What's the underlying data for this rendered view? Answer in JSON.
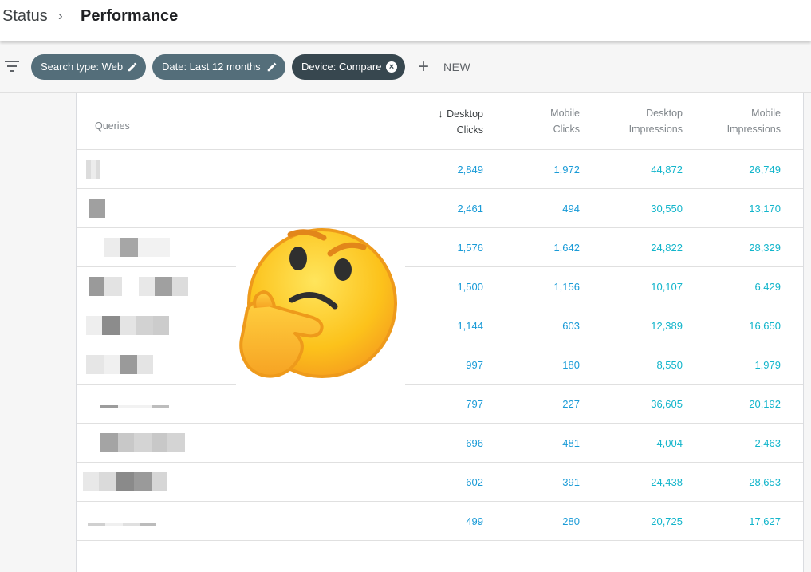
{
  "breadcrumb": {
    "previous": "Status",
    "separator": "›",
    "current": "Performance"
  },
  "filters": {
    "chips": [
      {
        "label": "Search type: Web",
        "icon": "edit-icon"
      },
      {
        "label": "Date: Last 12 months",
        "icon": "edit-icon"
      },
      {
        "label": "Device: Compare",
        "icon": "close-icon"
      }
    ],
    "new_label": "NEW",
    "new_icon": "+"
  },
  "table": {
    "headers": {
      "queries": "Queries",
      "desktop_clicks": [
        "Desktop",
        "Clicks"
      ],
      "mobile_clicks": [
        "Mobile",
        "Clicks"
      ],
      "desktop_impressions": [
        "Desktop",
        "Impressions"
      ],
      "mobile_impressions": [
        "Mobile",
        "Impressions"
      ]
    },
    "sort_arrow": "↓",
    "rows": [
      {
        "desktop_clicks": "2,849",
        "mobile_clicks": "1,972",
        "desktop_impressions": "44,872",
        "mobile_impressions": "26,749"
      },
      {
        "desktop_clicks": "2,461",
        "mobile_clicks": "494",
        "desktop_impressions": "30,550",
        "mobile_impressions": "13,170"
      },
      {
        "desktop_clicks": "1,576",
        "mobile_clicks": "1,642",
        "desktop_impressions": "24,822",
        "mobile_impressions": "28,329"
      },
      {
        "desktop_clicks": "1,500",
        "mobile_clicks": "1,156",
        "desktop_impressions": "10,107",
        "mobile_impressions": "6,429"
      },
      {
        "desktop_clicks": "1,144",
        "mobile_clicks": "603",
        "desktop_impressions": "12,389",
        "mobile_impressions": "16,650"
      },
      {
        "desktop_clicks": "997",
        "mobile_clicks": "180",
        "desktop_impressions": "8,550",
        "mobile_impressions": "1,979"
      },
      {
        "desktop_clicks": "797",
        "mobile_clicks": "227",
        "desktop_impressions": "36,605",
        "mobile_impressions": "20,192"
      },
      {
        "desktop_clicks": "696",
        "mobile_clicks": "481",
        "desktop_impressions": "4,004",
        "mobile_impressions": "2,463"
      },
      {
        "desktop_clicks": "602",
        "mobile_clicks": "391",
        "desktop_impressions": "24,438",
        "mobile_impressions": "28,653"
      },
      {
        "desktop_clicks": "499",
        "mobile_clicks": "280",
        "desktop_impressions": "20,725",
        "mobile_impressions": "17,627"
      }
    ]
  },
  "overlay": {
    "emoji": "thinking-face-emoji"
  },
  "colors": {
    "chip": "#546e7a",
    "chip_active": "#37474f",
    "clicks": "#1a9bd7",
    "impressions": "#12b5cb"
  }
}
